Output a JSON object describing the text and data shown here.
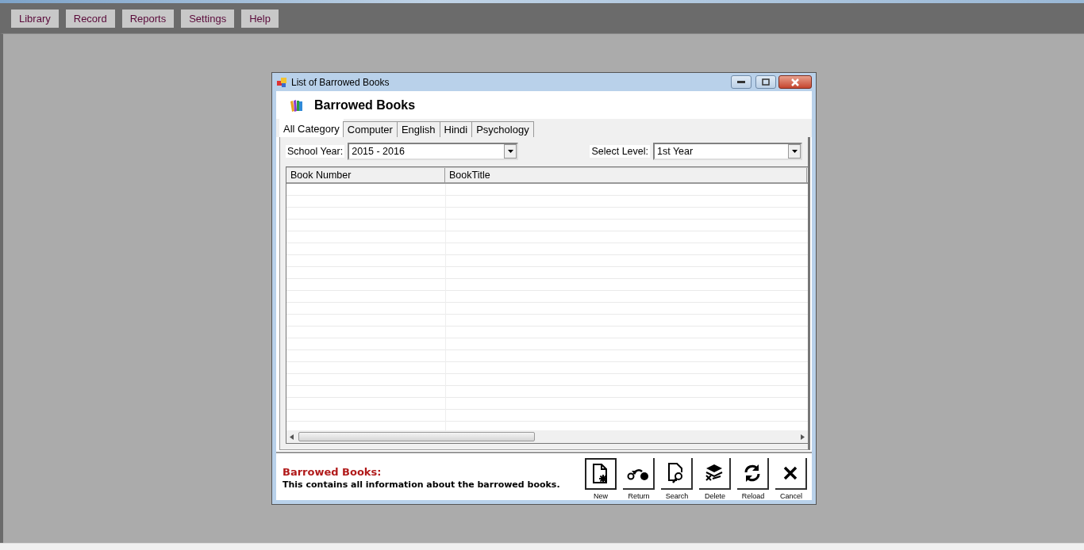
{
  "menu": [
    "Library",
    "Record",
    "Reports",
    "Settings",
    "Help"
  ],
  "window": {
    "title": "List of Barrowed Books",
    "heading": "Barrowed Books"
  },
  "tabs": [
    {
      "label": "All Category",
      "selected": true
    },
    {
      "label": "Computer",
      "selected": false
    },
    {
      "label": "English",
      "selected": false
    },
    {
      "label": "Hindi",
      "selected": false
    },
    {
      "label": "Psychology",
      "selected": false
    }
  ],
  "filters": [
    {
      "label": "School Year:",
      "value": "2015 - 2016"
    },
    {
      "label": "Select Level:",
      "value": "1st Year"
    }
  ],
  "table": {
    "columns": [
      "Book Number",
      "BookTitle"
    ]
  },
  "info": {
    "title": "Barrowed Books:",
    "text": "This contains all information about the barrowed books."
  },
  "buttons": [
    {
      "kind": "new",
      "label": "New"
    },
    {
      "kind": "return",
      "label": "Return"
    },
    {
      "kind": "search",
      "label": "Search"
    },
    {
      "kind": "delete",
      "label": "Delete"
    },
    {
      "kind": "reload",
      "label": "Reload"
    },
    {
      "kind": "cancel",
      "label": "Cancel"
    }
  ]
}
